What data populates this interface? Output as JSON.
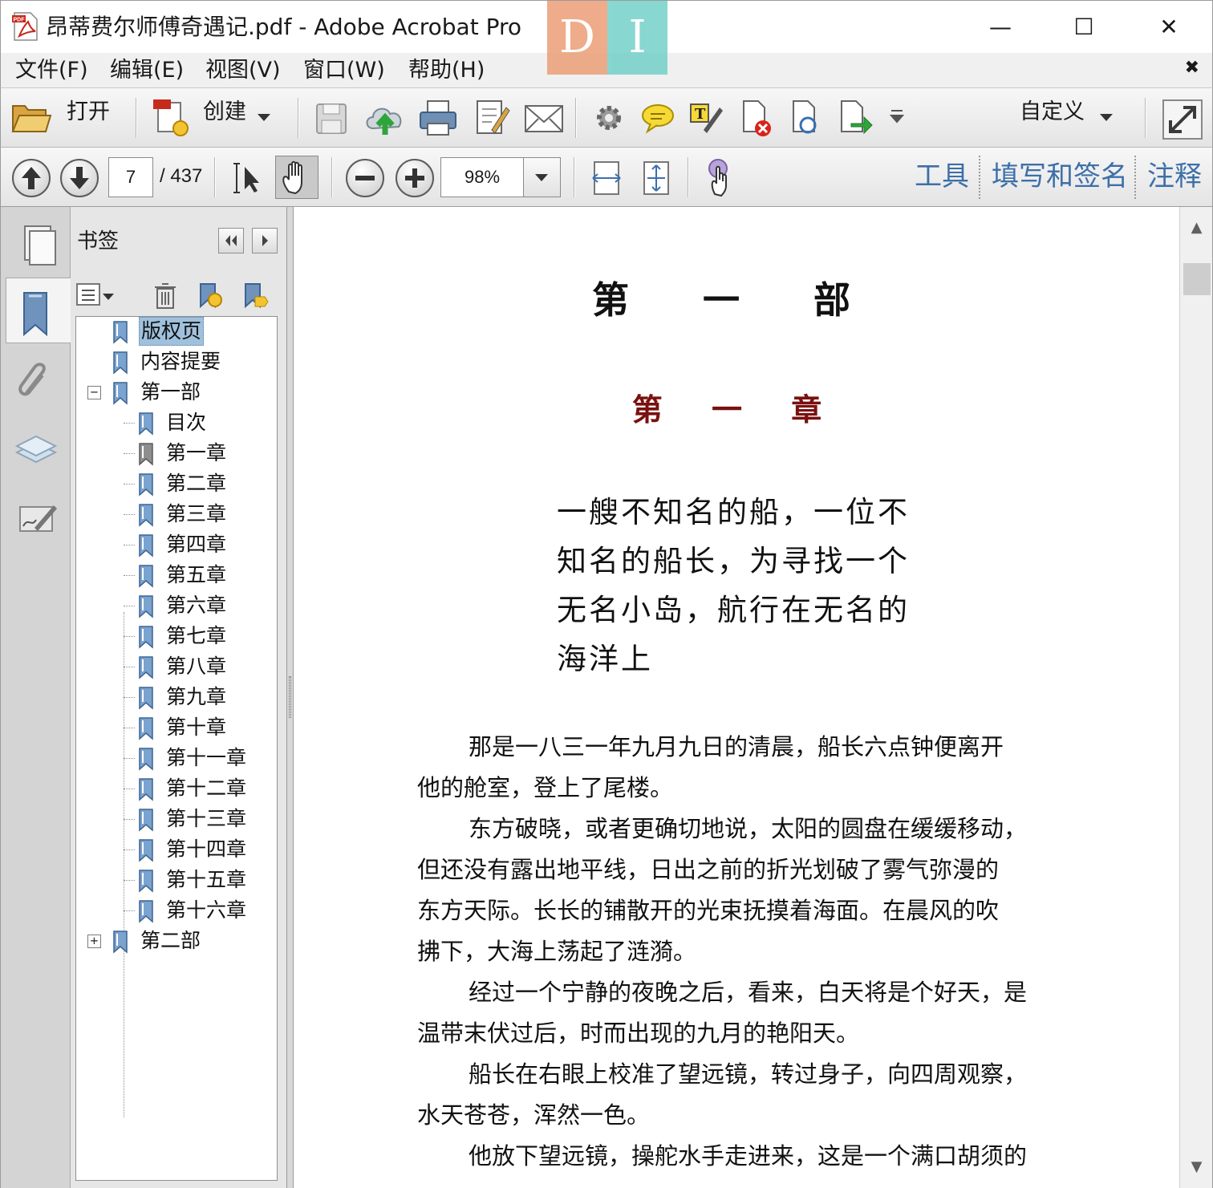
{
  "window": {
    "title": "昂蒂费尔师傅奇遇记.pdf - Adobe Acrobat Pro",
    "app_icon": "pdf-file-icon",
    "logo_left": "D",
    "logo_right": "I",
    "minimize": "—",
    "maximize": "☐",
    "close": "✕"
  },
  "menu": {
    "items": [
      "文件(F)",
      "编辑(E)",
      "视图(V)",
      "窗口(W)",
      "帮助(H)"
    ],
    "close_glyph": "✖"
  },
  "toolbar": {
    "open_label": "打开",
    "create_label": "创建",
    "customize_label": "自定义",
    "icons": [
      "folder-open-icon",
      "create-pdf-icon",
      "save-icon",
      "cloud-upload-icon",
      "print-icon",
      "edit-document-icon",
      "email-icon",
      "gear-icon",
      "comment-icon",
      "highlight-text-icon",
      "delete-pdf-icon",
      "search-document-icon",
      "export-icon",
      "toolbar-overflow-icon",
      "expand-icon"
    ]
  },
  "navigation": {
    "current_page": "7",
    "total_pages": "/ 437",
    "zoom": "98%",
    "panes": [
      "工具",
      "填写和签名",
      "注释"
    ]
  },
  "bookmarks": {
    "title": "书签",
    "items": [
      {
        "label": "版权页",
        "level": 0,
        "selected": true
      },
      {
        "label": "内容提要",
        "level": 0
      },
      {
        "label": "第一部",
        "level": 0,
        "expander": "−"
      },
      {
        "label": "目次",
        "level": 1
      },
      {
        "label": "第一章",
        "level": 1,
        "gray": true
      },
      {
        "label": "第二章",
        "level": 1
      },
      {
        "label": "第三章",
        "level": 1
      },
      {
        "label": "第四章",
        "level": 1
      },
      {
        "label": "第五章",
        "level": 1
      },
      {
        "label": "第六章",
        "level": 1
      },
      {
        "label": "第七章",
        "level": 1
      },
      {
        "label": "第八章",
        "level": 1
      },
      {
        "label": "第九章",
        "level": 1
      },
      {
        "label": "第十章",
        "level": 1
      },
      {
        "label": "第十一章",
        "level": 1
      },
      {
        "label": "第十二章",
        "level": 1
      },
      {
        "label": "第十三章",
        "level": 1
      },
      {
        "label": "第十四章",
        "level": 1
      },
      {
        "label": "第十五章",
        "level": 1
      },
      {
        "label": "第十六章",
        "level": 1
      },
      {
        "label": "第二部",
        "level": 0,
        "expander": "+"
      }
    ]
  },
  "document": {
    "part_title": "第 一 部",
    "chapter_title": "第 一 章",
    "epigraph": [
      "一艘不知名的船，一位不",
      "知名的船长，为寻找一个",
      "无名小岛，航行在无名的",
      "海洋上"
    ],
    "lines": [
      {
        "text": "那是一八三一年九月九日的清晨，船长六点钟便离开",
        "indent": true
      },
      {
        "text": "他的舱室，登上了尾楼。",
        "indent": false
      },
      {
        "text": "东方破晓，或者更确切地说，太阳的圆盘在缓缓移动，",
        "indent": true
      },
      {
        "text": "但还没有露出地平线，日出之前的折光划破了雾气弥漫的",
        "indent": false
      },
      {
        "text": "东方天际。长长的铺散开的光束抚摸着海面。在晨风的吹",
        "indent": false
      },
      {
        "text": "拂下，大海上荡起了涟漪。",
        "indent": false
      },
      {
        "text": "经过一个宁静的夜晚之后，看来，白天将是个好天，是",
        "indent": true
      },
      {
        "text": "温带末伏过后，时而出现的九月的艳阳天。",
        "indent": false
      },
      {
        "text": "船长在右眼上校准了望远镜，转过身子，向四周观察，",
        "indent": true
      },
      {
        "text": "水天苍苍，浑然一色。",
        "indent": false
      },
      {
        "text": "他放下望远镜，操舵水手走进来，这是一个满口胡须的",
        "indent": true
      }
    ]
  },
  "scrollbar": {
    "up": "▲",
    "down": "▼"
  },
  "colors": {
    "chapter_title": "#7a1010",
    "pane_link": "#3d6fa8",
    "selection": "#9fc1dd"
  }
}
